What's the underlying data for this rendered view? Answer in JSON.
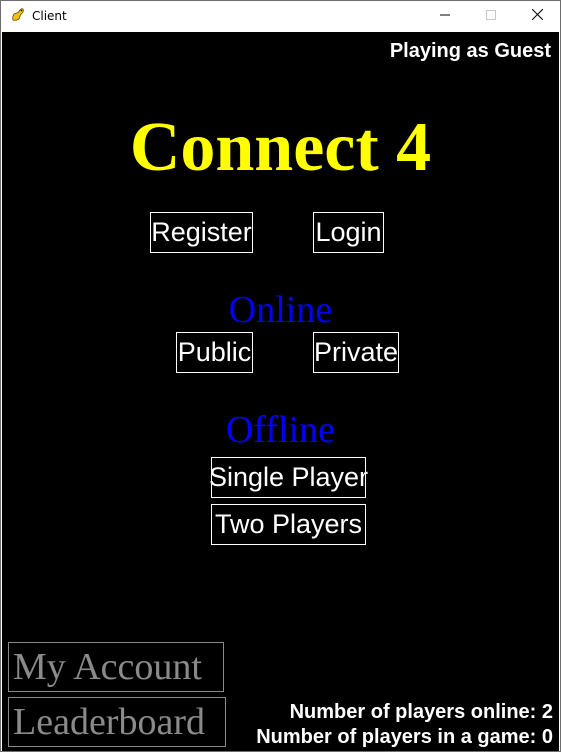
{
  "window": {
    "title": "Client",
    "app_icon": "pygame-snake-icon",
    "controls": {
      "minimize_icon": "minimize-icon",
      "maximize_icon": "maximize-icon",
      "close_icon": "close-icon"
    }
  },
  "header": {
    "status": "Playing as Guest"
  },
  "title": "Connect 4",
  "account": {
    "register_label": "Register",
    "login_label": "Login"
  },
  "online": {
    "heading": "Online",
    "public_label": "Public",
    "private_label": "Private"
  },
  "offline": {
    "heading": "Offline",
    "single_player_label": "Single Player",
    "two_players_label": "Two Players"
  },
  "footer": {
    "my_account_label": "My Account",
    "leaderboard_label": "Leaderboard",
    "players_online": "Number of players online: 2",
    "players_in_game": "Number of players in a game: 0"
  },
  "colors": {
    "background": "#000000",
    "title": "#ffff00",
    "section_heading": "#0000ff",
    "button_text": "#ffffff",
    "disabled_button": "#8a8a8a"
  }
}
